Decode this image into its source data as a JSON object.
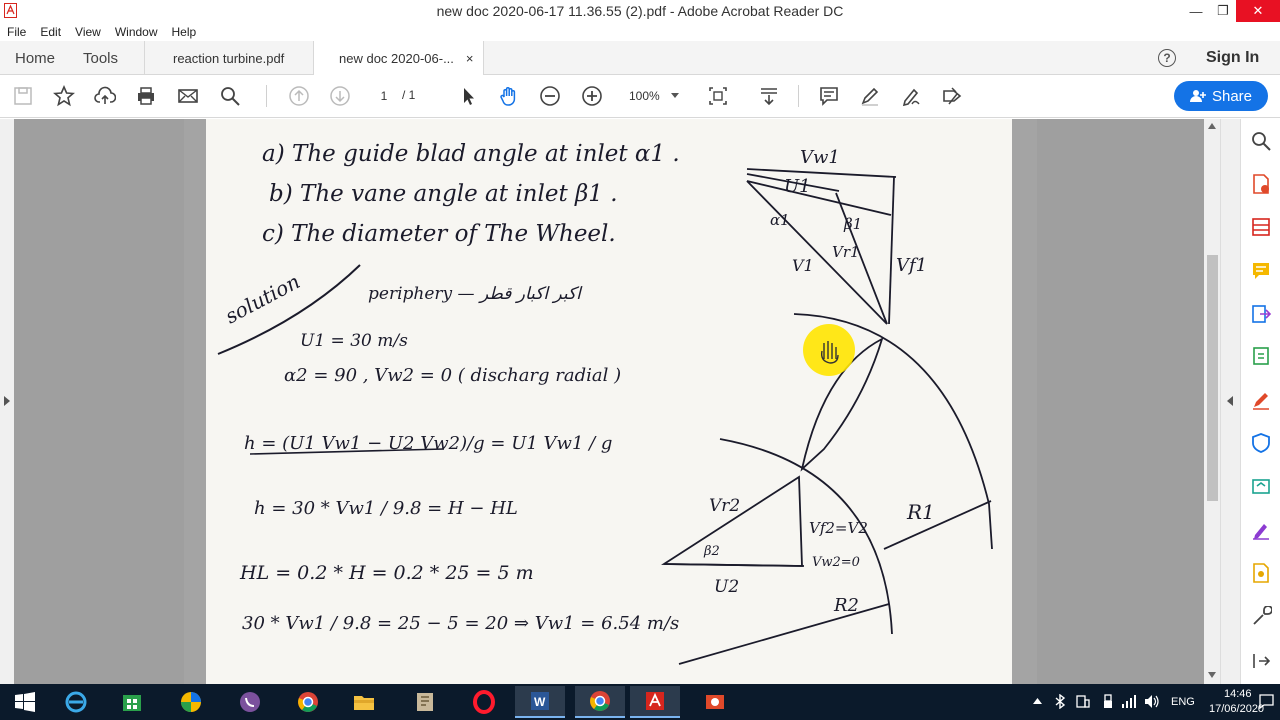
{
  "window": {
    "title": "new doc 2020-06-17 11.36.55 (2).pdf - Adobe Acrobat Reader DC",
    "minimize": "—",
    "maximize": "❐",
    "close": "✕"
  },
  "menu": [
    "File",
    "Edit",
    "View",
    "Window",
    "Help"
  ],
  "tabs": {
    "home": "Home",
    "tools": "Tools",
    "doc1": "reaction turbine.pdf",
    "doc2": "new doc 2020-06-...",
    "close": "×"
  },
  "header": {
    "help": "?",
    "signin": "Sign In"
  },
  "toolbar": {
    "page_current": "1",
    "page_total": "/ 1",
    "zoom": "100%",
    "share": "Share"
  },
  "colors": {
    "accent": "#1473e6",
    "close": "#e81123",
    "acrobat_red": "#d7261e",
    "taskbar": "#0b1a2b",
    "highlight": "#ffe600"
  },
  "document": {
    "lines": [
      "a) The guide blad angle at inlet α1 .",
      "b) The vane angle at inlet β1 .",
      "c) The diameter of The Wheel.",
      "solution",
      "periphery — اكبر اكبار قطر",
      "U1 = 30 m/s",
      "α2 = 90 , Vw2 = 0 ( discharg radial )",
      "h = (U1 Vw1 − U2 Vw2)/g = U1 Vw1 / g",
      "h = 30 * Vw1 / 9.8 = H − HL",
      "HL = 0.2 * H = 0.2 * 25 = 5 m",
      "30 * Vw1 / 9.8 = 25 − 5 = 20 ⇒ Vw1 = 6.54 m/s"
    ],
    "diagram_labels": {
      "vw1": "Vw1",
      "u1": "U1",
      "alpha1": "α1",
      "beta1": "β1",
      "v1": "V1",
      "vr1": "Vr1",
      "vf1": "Vf1",
      "vr2": "Vr2",
      "beta2": "β2",
      "vf2": "Vf2=V2",
      "vw2": "Vw2=0",
      "u2": "U2",
      "r1": "R1",
      "r2": "R2"
    }
  },
  "tray": {
    "lang": "ENG",
    "time": "14:46",
    "date": "17/06/2020"
  }
}
